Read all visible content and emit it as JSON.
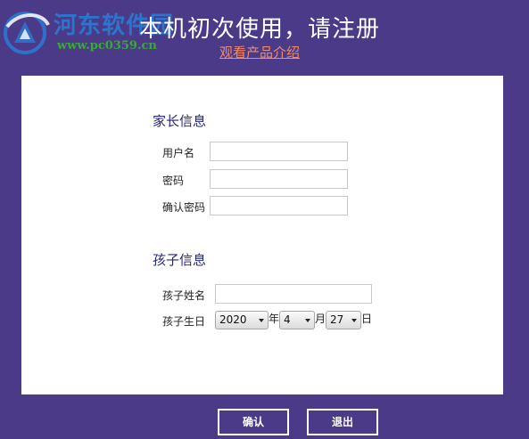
{
  "watermark": {
    "site_name": "河东软件园",
    "url": "www.pc0359.cn"
  },
  "header": {
    "title": "本机初次使用，请注册",
    "product_link": "观看产品介绍"
  },
  "parent_section": {
    "title": "家长信息",
    "username_label": "用户名",
    "username_value": "",
    "password_label": "密码",
    "password_value": "",
    "confirm_password_label": "确认密码",
    "confirm_password_value": ""
  },
  "child_section": {
    "title": "孩子信息",
    "name_label": "孩子姓名",
    "name_value": "",
    "birthday_label": "孩子生日",
    "year_value": "2020",
    "year_unit": "年",
    "month_value": "4",
    "month_unit": "月",
    "day_value": "27",
    "day_unit": "日"
  },
  "buttons": {
    "confirm_label": "确认",
    "exit_label": "退出"
  },
  "colors": {
    "background": "#4b3a88",
    "section_title": "#26267a",
    "link": "#f08a6c"
  }
}
